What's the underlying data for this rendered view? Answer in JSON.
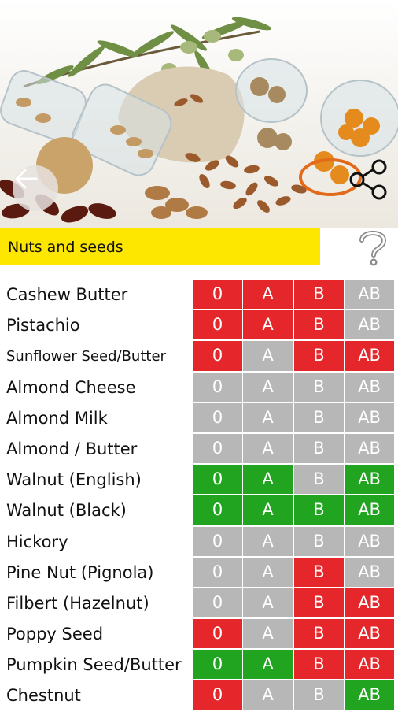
{
  "header": {
    "category_title": "Nuts and seeds"
  },
  "icons": {
    "back": "arrow-left-icon",
    "share": "share-icon",
    "help": "question-mark-icon"
  },
  "colors": {
    "green": "#21a41f",
    "red": "#e5262a",
    "grey": "#b7b7b7",
    "yellow": "#fde600"
  },
  "blood_types": [
    "0",
    "A",
    "B",
    "AB"
  ],
  "foods": [
    {
      "name": "Cashew Butter",
      "status": [
        "red",
        "red",
        "red",
        "grey"
      ]
    },
    {
      "name": "Pistachio",
      "status": [
        "red",
        "red",
        "red",
        "grey"
      ]
    },
    {
      "name": "Sunflower Seed/Butter",
      "status": [
        "red",
        "grey",
        "red",
        "red"
      ]
    },
    {
      "name": "Almond Cheese",
      "status": [
        "grey",
        "grey",
        "grey",
        "grey"
      ]
    },
    {
      "name": "Almond Milk",
      "status": [
        "grey",
        "grey",
        "grey",
        "grey"
      ]
    },
    {
      "name": "Almond / Butter",
      "status": [
        "grey",
        "grey",
        "grey",
        "grey"
      ]
    },
    {
      "name": "Walnut (English)",
      "status": [
        "green",
        "green",
        "grey",
        "green"
      ]
    },
    {
      "name": "Walnut (Black)",
      "status": [
        "green",
        "green",
        "green",
        "green"
      ]
    },
    {
      "name": "Hickory",
      "status": [
        "grey",
        "grey",
        "grey",
        "grey"
      ]
    },
    {
      "name": "Pine Nut (Pignola)",
      "status": [
        "grey",
        "grey",
        "red",
        "grey"
      ]
    },
    {
      "name": "Filbert (Hazelnut)",
      "status": [
        "grey",
        "grey",
        "red",
        "red"
      ]
    },
    {
      "name": "Poppy Seed",
      "status": [
        "red",
        "grey",
        "red",
        "red"
      ]
    },
    {
      "name": "Pumpkin Seed/Butter",
      "status": [
        "green",
        "green",
        "red",
        "red"
      ]
    },
    {
      "name": "Chestnut",
      "status": [
        "red",
        "grey",
        "grey",
        "green"
      ]
    }
  ]
}
